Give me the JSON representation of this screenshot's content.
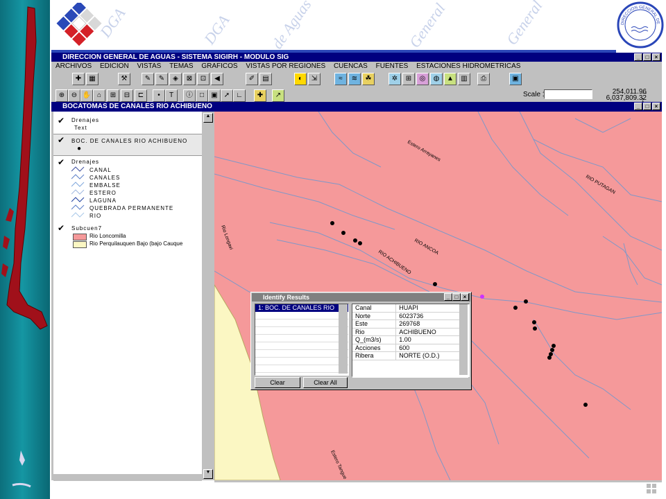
{
  "main_window": {
    "title": "DIRECCION GENERAL DE AGUAS - SISTEMA SIGIRH - MODULO SIG"
  },
  "seal": {
    "text": "DIRECCION GENERAL DE AGUAS"
  },
  "watermarks": [
    "DGA",
    "General",
    "de Aguas",
    "DGA",
    "General"
  ],
  "menu": [
    "ARCHIVOS",
    "EDICION",
    "VISTAS",
    "TEMAS",
    "GRAFICOS",
    "VISTAS POR REGIONES",
    "CUENCAS",
    "FUENTES",
    "ESTACIONES HIDROMETRICAS"
  ],
  "scale": {
    "label": "Scale 1:",
    "value": "",
    "coord_x": "254,011.96",
    "coord_y": "6,037,809.32"
  },
  "view_window": {
    "title": "BOCATOMAS DE CANALES RIO ACHIBUENO"
  },
  "legend": {
    "group1": {
      "title": "Drenajes",
      "sub": "Text"
    },
    "group2": {
      "title": "BOC. DE CANALES RIO ACHIBUENO"
    },
    "group3": {
      "title": "Drenajes",
      "items": [
        "CANAL",
        "CANALES",
        "EMBALSE",
        "ESTERO",
        "LAGUNA",
        "QUEBRADA PERMANENTE",
        "RIO"
      ]
    },
    "group4": {
      "title": "Subcuen7",
      "items": [
        "Rio Loncomilla",
        "Rio Perquilauquen Bajo (bajo Cauque"
      ]
    }
  },
  "map_labels": [
    "Estero Arrayanes",
    "RIO PUTAGAN",
    "Rio Longavi",
    "RIO ANCOA",
    "RIO ACHIBUENO",
    "Estero Tangue"
  ],
  "colors": {
    "map_fill": "#f5999a",
    "lowland_fill": "#fbf7c3",
    "river": "#7f98c8",
    "titlebar": "#000080"
  },
  "identify": {
    "title": "Identify Results",
    "list": [
      "1: BOC. DE CANALES RIO"
    ],
    "rows": [
      {
        "field": "Canal",
        "value": "HUAPI"
      },
      {
        "field": "Norte",
        "value": "6023736"
      },
      {
        "field": "Este",
        "value": "269768"
      },
      {
        "field": "Rio",
        "value": "ACHIBUENO"
      },
      {
        "field": "Q_(m3/s)",
        "value": "1.00"
      },
      {
        "field": "Acciones",
        "value": "600"
      },
      {
        "field": "Ribera",
        "value": "NORTE   (O.D.)"
      }
    ],
    "clear_label": "Clear",
    "clear_all_label": "Clear All"
  }
}
